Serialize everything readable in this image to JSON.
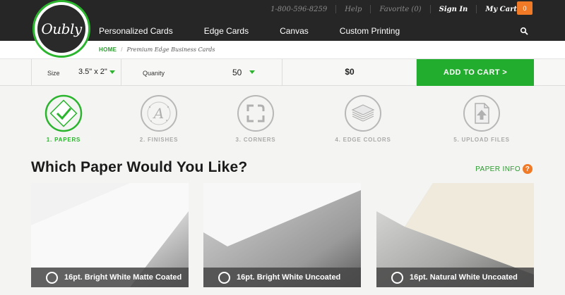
{
  "logo": {
    "text": "Oubly"
  },
  "utility": {
    "phone": "1-800-596-8259",
    "help": "Help",
    "favorite": "Favorite (0)",
    "sign_in": "Sign In",
    "cart": "My Cart",
    "cart_count": "0"
  },
  "nav": {
    "items": [
      {
        "label": "Personalized Cards"
      },
      {
        "label": "Edge Cards"
      },
      {
        "label": "Canvas"
      },
      {
        "label": "Custom Printing"
      }
    ]
  },
  "breadcrumb": {
    "home": "HOME",
    "separator": "/",
    "current": "Premium Edge Business Cards"
  },
  "options": {
    "size_label": "Size",
    "size_value": "3.5\" x 2\"",
    "quantity_label": "Quanity",
    "quantity_value": "50",
    "price": "$0",
    "add_to_cart": "ADD TO CART >"
  },
  "steps": [
    {
      "label": "1. PAPERS",
      "icon": "papers-icon",
      "active": true
    },
    {
      "label": "2. FINISHES",
      "icon": "finishes-icon",
      "active": false
    },
    {
      "label": "3. CORNERS",
      "icon": "corners-icon",
      "active": false
    },
    {
      "label": "4. EDGE COLORS",
      "icon": "edge-colors-icon",
      "active": false
    },
    {
      "label": "5. UPLOAD FILES",
      "icon": "upload-files-icon",
      "active": false
    }
  ],
  "section": {
    "heading": "Which Paper Would You Like?",
    "paper_info": "PAPER INFO",
    "help_glyph": "?"
  },
  "papers": [
    {
      "label": "16pt. Bright White Matte Coated"
    },
    {
      "label": "16pt. Bright White Uncoated"
    },
    {
      "label": "16pt. Natural White Uncoated"
    }
  ],
  "colors": {
    "accent": "#2bb52e",
    "header": "#262626",
    "badge": "#f07a26"
  }
}
